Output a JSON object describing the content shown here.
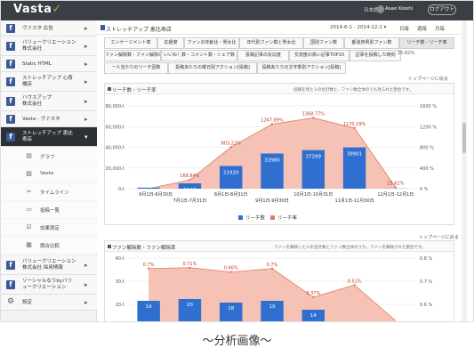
{
  "header": {
    "logo_text": "Vasta",
    "logo_check": "✓",
    "language": "日本語",
    "user_name": "Asao Koishi",
    "logout_label": "ログアウト"
  },
  "sidebar": {
    "items": [
      {
        "label_line1": "ヴァスタ 広告",
        "label_line2": "",
        "icon": "facebook-icon"
      },
      {
        "label_line1": "バリュークリエーション",
        "label_line2": "株式会社",
        "icon": "facebook-icon"
      },
      {
        "label_line1": "Static HTML",
        "label_line2": "",
        "icon": "facebook-icon"
      },
      {
        "label_line1": "ストレッチアップ 心斎",
        "label_line2": "橋店",
        "icon": "facebook-icon"
      },
      {
        "label_line1": "ハウスアップ",
        "label_line2": "株式会社",
        "icon": "facebook-icon"
      },
      {
        "label_line1": "Vasta - ヴァスタ",
        "label_line2": "",
        "icon": "facebook-icon"
      },
      {
        "label_line1": "ストレッチアップ 恵比",
        "label_line2": "寿店",
        "icon": "facebook-icon"
      }
    ],
    "subitems": [
      {
        "label": "グラフ",
        "icon": "chart-icon"
      },
      {
        "label": "Vasta",
        "icon": "image-icon"
      },
      {
        "label": "タイムライン",
        "icon": "link-icon"
      },
      {
        "label": "投稿一覧",
        "icon": "folder-icon"
      },
      {
        "label": "効果測定",
        "icon": "check-icon"
      },
      {
        "label": "競合比較",
        "icon": "compare-icon"
      }
    ],
    "bottom_items": [
      {
        "label_line1": "バリュークリエーション",
        "label_line2": "株式会社 採用情報",
        "icon": "facebook-icon"
      },
      {
        "label_line1": "ソーシャルなうbyバリ",
        "label_line2": "ュークリエーション",
        "icon": "facebook-icon"
      },
      {
        "label_line1": "設定",
        "label_line2": "",
        "icon": "gear-icon"
      }
    ]
  },
  "main": {
    "page_title": "ストレッチアップ 恵比寿店",
    "date_range": "2014-6-1 - 2014-12-1 ▾",
    "range_day": "日毎",
    "range_week": "週毎",
    "range_month": "月毎",
    "tabs_row1": [
      "エンゲージメント率",
      "応援度",
      "ファンの年齢比・男女比",
      "年代別ファン数と男女比",
      "国別ファン数",
      "都道府県別ファン数",
      "リーチ数・リーチ率"
    ],
    "tabs_row2": [
      "ファン解除数・ファン解除率",
      "いいね！数・コメント数・シェア数",
      "投稿記事の反応度",
      "交流度の高い記事TOP10",
      "記事を投稿した時刻"
    ],
    "tabs_row3": [
      "一人当たりのリーチ回数",
      "投稿あたりの曜日別アクション[投稿]",
      "投稿あたりの文字数別アクション[投稿]"
    ],
    "help_text": "トップページに戻る",
    "percent_note": "25.62%"
  },
  "panel1": {
    "title": "リーチ数・リーチ率",
    "note": "投稿を見た人の合計数と、ファン数全体のうち見られた割合です。",
    "legend_bar": "リーチ数",
    "legend_line": "リーチ率",
    "help_text": "トップページに戻る"
  },
  "panel2": {
    "title": "ファン解除数・ファン解除率",
    "note": "ファンを解除した人の合計数とファン数全体のうち、ファンを解除された割合です。"
  },
  "chart_data": [
    {
      "type": "bar",
      "title": "リーチ数・リーチ率",
      "categories": [
        "6月1日-6月30日",
        "7月1日-7月31日",
        "8月1日-8月31日",
        "9月1日-9月30日",
        "10月1日-10月31日",
        "11月1日-11月30日",
        "12月1日-12月1日"
      ],
      "x_tick_labels_upper": [
        "6月1日-6月30日",
        "8月1日-8月31日",
        "10月1日-10月31日",
        "12月1日-12月1日"
      ],
      "x_tick_labels_lower": [
        "7月1日-7月31日",
        "9月1日-9月30日",
        "11月1日-11月30日"
      ],
      "series": [
        {
          "name": "リーチ数",
          "axis": "left",
          "values": [
            1013,
            5147,
            21920,
            33980,
            37299,
            39901,
            160
          ],
          "labels": [
            "",
            "5147",
            "21920",
            "33980",
            "37299",
            "39901",
            ""
          ]
        },
        {
          "name": "リーチ率",
          "axis": "right",
          "values": [
            0,
            168.84,
            803.22,
            1247.89,
            1368.77,
            1170.29,
            25.62
          ],
          "labels": [
            "",
            "168.84%",
            "803.22%",
            "1247.89%",
            "1368.77%",
            "1170.29%",
            "25.62%"
          ]
        }
      ],
      "ylim_left": [
        0,
        60000
      ],
      "yticks_left": [
        "0人",
        "20,000人",
        "40,000人",
        "60,000人",
        "80,000人"
      ],
      "ylim_right": [
        0,
        1600
      ],
      "yticks_right": [
        "0 %",
        "400 %",
        "800 %",
        "1200 %",
        "1600 %"
      ],
      "colors": {
        "bar": "#2f6fcf",
        "area": "#f4b7a8",
        "line": "#e07a5f"
      },
      "legend_placement": "bottom-center",
      "grid": true
    },
    {
      "type": "bar",
      "title": "ファン解除数・ファン解除率",
      "series": [
        {
          "name": "ファン解除数",
          "axis": "left",
          "values": [
            19,
            20,
            18,
            19,
            14
          ],
          "labels": [
            "19",
            "20",
            "18",
            "19",
            "14"
          ]
        },
        {
          "name": "ファン解除率",
          "axis": "right",
          "values": [
            0.7,
            0.71,
            0.66,
            0.7,
            0.37,
            0.51,
            0.1
          ],
          "labels": [
            "0.7%",
            "0.71%",
            "0.66%",
            "0.7%",
            "0.37%",
            "0.51%",
            ""
          ]
        }
      ],
      "yticks_left": [
        "20人",
        "30人",
        "40人"
      ],
      "yticks_right": [
        "0.6 %",
        "0.7 %",
        "0.8 %"
      ],
      "colors": {
        "bar": "#2f6fcf",
        "area": "#f4b7a8",
        "line": "#e07a5f"
      }
    }
  ],
  "caption": "～分析画像～"
}
